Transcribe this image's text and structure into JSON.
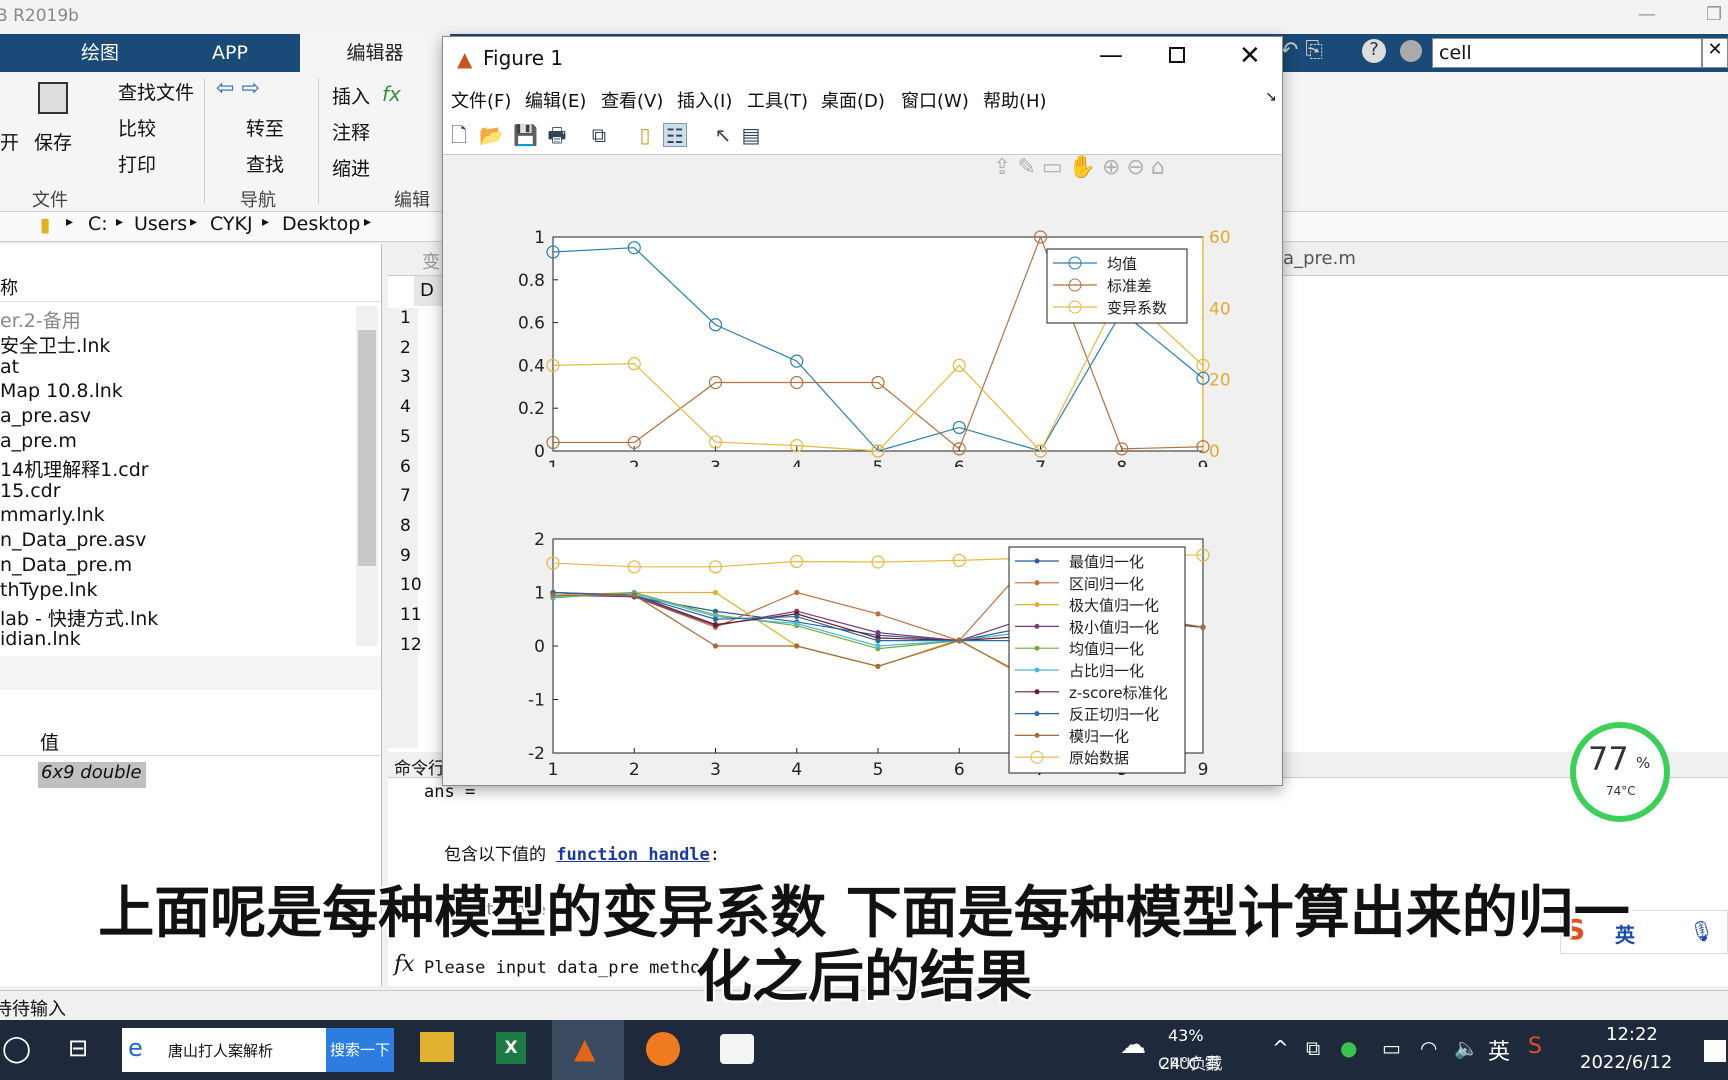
{
  "window": {
    "title": "B R2019b"
  },
  "tabs": [
    "绘图",
    "APP",
    "编辑器"
  ],
  "search": {
    "value": "cell"
  },
  "ribbon": {
    "open": "开",
    "save": "保存",
    "find_files": "查找文件",
    "compare": "比较",
    "print": "打印",
    "goto": "转至",
    "find": "查找",
    "insert": "插入",
    "comment": "注释",
    "indent": "缩进",
    "groups": [
      "文件",
      "导航",
      "编辑"
    ]
  },
  "path": [
    "C:",
    "Users",
    "CYKJ",
    "Desktop"
  ],
  "file_browser": {
    "header_col": "称",
    "items": [
      "er.2-备用",
      "安全卫士.lnk",
      "at",
      "Map 10.8.lnk",
      "a_pre.asv",
      "a_pre.m",
      "14机理解释1.cdr",
      "15.cdr",
      "mmarly.lnk",
      "n_Data_pre.asv",
      "n_Data_pre.m",
      "thType.lnk",
      "lab - 快捷方式.lnk",
      "idian.lnk"
    ]
  },
  "workspace": {
    "col_value": "值",
    "value": "6x9 double"
  },
  "editor": {
    "tab_left": "D",
    "tab_right": "ta_pre.m",
    "line_numbers": [
      "1",
      "2",
      "3",
      "4",
      "5",
      "6",
      "7",
      "8",
      "9",
      "10",
      "11",
      "12"
    ],
    "doc_tab": "变"
  },
  "command": {
    "title": "命令行",
    "ans": "ans =",
    "func_text": "包含以下值的",
    "func_link": "function handle",
    "func_colon": ":",
    "hidden": "data_pre",
    "prompt": "Please input data_pre method n"
  },
  "status": {
    "text": "待待输入"
  },
  "figure": {
    "title": "Figure 1",
    "menu": [
      "文件(F)",
      "编辑(E)",
      "查看(V)",
      "插入(I)",
      "工具(T)",
      "桌面(D)",
      "窗口(W)",
      "帮助(H)"
    ]
  },
  "subtitle": {
    "line1": "上面呢是每种模型的变异系数 下面是每种模型计算出来的归一",
    "line2": "化之后的结果"
  },
  "gauge": {
    "percent": "77",
    "unit": "%",
    "temp": "74°C"
  },
  "ime": {
    "lang": "英"
  },
  "taskbar": {
    "search_text": "唐山打人案解析",
    "search_btn": "搜索一下",
    "weather": "24°C 雾",
    "cpu": "43%",
    "cpu_label": "CPU负载",
    "lang": "英",
    "time": "12:22",
    "date": "2022/6/12"
  },
  "chart_data": [
    {
      "type": "line",
      "x": [
        1,
        2,
        3,
        4,
        5,
        6,
        7,
        8,
        9
      ],
      "xlim": [
        1,
        9
      ],
      "ylim": [
        0,
        1
      ],
      "y2lim": [
        0,
        60
      ],
      "yticks": [
        "0",
        "0.2",
        "0.4",
        "0.6",
        "0.8",
        "1"
      ],
      "y2ticks": [
        "0",
        "20",
        "40",
        "60"
      ],
      "grid": false,
      "legend": "top-right",
      "series": [
        {
          "name": "均值",
          "axis": "left",
          "color": "#2a7fb0",
          "values": [
            0.93,
            0.95,
            0.59,
            0.42,
            0,
            0.11,
            0,
            0.65,
            0.34
          ]
        },
        {
          "name": "标准差",
          "axis": "left",
          "color": "#b5713f",
          "values": [
            0.04,
            0.04,
            0.32,
            0.32,
            0.32,
            0.01,
            1.0,
            0.01,
            0.02
          ]
        },
        {
          "name": "变异系数",
          "axis": "right",
          "color": "#e8b840",
          "values": [
            24,
            24.5,
            2.5,
            1.5,
            0,
            24,
            0,
            45,
            24
          ]
        }
      ]
    },
    {
      "type": "line",
      "x": [
        1,
        2,
        3,
        4,
        5,
        6,
        7,
        8,
        9
      ],
      "xlim": [
        1,
        9
      ],
      "ylim": [
        -2,
        2
      ],
      "yticks": [
        "-2",
        "-1",
        "0",
        "1",
        "2"
      ],
      "grid": false,
      "legend": "right",
      "series": [
        {
          "name": "最值归一化",
          "color": "#2a5f9e",
          "values": [
            1,
            0.92,
            0.65,
            0.45,
            0.2,
            0.1,
            0.4,
            0.5,
            0.35
          ]
        },
        {
          "name": "区间归一化",
          "color": "#c07040",
          "values": [
            1,
            0.92,
            0.35,
            1.0,
            0.6,
            0.1,
            1.8,
            0.6,
            0.35
          ]
        },
        {
          "name": "极大值归一化",
          "color": "#e0b030",
          "values": [
            0.95,
            1.0,
            1.0,
            0.0,
            -0.38,
            0.12,
            -0.75,
            0.6,
            0.35
          ]
        },
        {
          "name": "极小值归一化",
          "color": "#7a3a7a",
          "values": [
            0.95,
            0.92,
            0.38,
            0.65,
            0.25,
            0.1,
            0.6,
            0.5,
            0.35
          ]
        },
        {
          "name": "均值归一化",
          "color": "#77a83a",
          "values": [
            0.9,
            1.0,
            0.58,
            0.38,
            -0.05,
            0.1,
            0.3,
            0.5,
            0.35
          ]
        },
        {
          "name": "占比归一化",
          "color": "#4fb8d8",
          "values": [
            0.92,
            0.98,
            0.55,
            0.42,
            0.0,
            0.1,
            0.3,
            0.5,
            0.35
          ]
        },
        {
          "name": "z-score标准化",
          "color": "#6a1f2a",
          "values": [
            1,
            0.95,
            0.4,
            0.6,
            0.15,
            0.1,
            0.2,
            0.5,
            0.35
          ]
        },
        {
          "name": "反正切归一化",
          "color": "#2a6a9e",
          "values": [
            1,
            0.95,
            0.5,
            0.55,
            0.1,
            0.1,
            0.1,
            0.5,
            0.35
          ]
        },
        {
          "name": "模归一化",
          "color": "#a86a3a",
          "values": [
            0.95,
            0.95,
            0.0,
            0.0,
            -0.38,
            0.1,
            -0.7,
            0.6,
            0.35
          ]
        },
        {
          "name": "原始数据",
          "color": "#e8b840",
          "marker": "circle",
          "values": [
            1.55,
            1.48,
            1.48,
            1.58,
            1.57,
            1.6,
            1.65,
            1.7,
            1.7
          ]
        }
      ]
    }
  ]
}
